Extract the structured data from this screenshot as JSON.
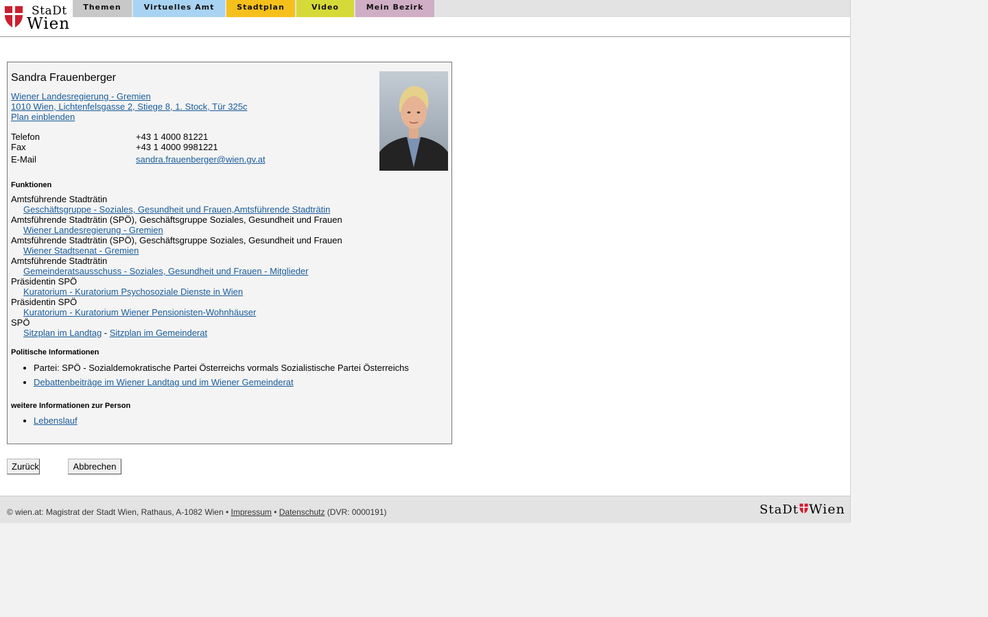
{
  "header": {
    "logo": {
      "word_top": "StaDt",
      "word_bottom": "Wien",
      "shield_colors": [
        "#cc1e2f",
        "#ffffff"
      ]
    },
    "nav_tabs": [
      {
        "label": "Themen",
        "color": "#c8c8c8"
      },
      {
        "label": "Virtuelles Amt",
        "color": "#a9d3f2"
      },
      {
        "label": "Stadtplan",
        "color": "#f6c01c"
      },
      {
        "label": "Video",
        "color": "#d6da38"
      },
      {
        "label": "Mein Bezirk",
        "color": "#d0aec5"
      }
    ]
  },
  "person": {
    "name": "Sandra Frauenberger",
    "org_link": "Wiener Landesregierung - Gremien ",
    "address_link": "1010 Wien, Lichtenfelsgasse 2, Stiege 8, 1. Stock, Tür 325c",
    "map_link": "Plan einblenden",
    "contact": {
      "phone_label": "Telefon",
      "phone": "+43 1 4000 81221",
      "fax_label": "Fax",
      "fax": "+43 1 4000 9981221",
      "email_label": "E-Mail",
      "email": "sandra.frauenberger@wien.gv.at"
    },
    "functions_heading": "Funktionen",
    "functions": [
      {
        "title": "Amtsführende Stadträtin",
        "link": "Geschäftsgruppe - Soziales, Gesundheit und Frauen,Amtsführende Stadträtin"
      },
      {
        "title": "Amtsführende Stadträtin (SPÖ), Geschäftsgruppe Soziales, Gesundheit und Frauen",
        "link": "Wiener Landesregierung - Gremien"
      },
      {
        "title": "Amtsführende Stadträtin (SPÖ), Geschäftsgruppe Soziales, Gesundheit und Frauen",
        "link": "Wiener Stadtsenat - Gremien"
      },
      {
        "title": "Amtsführende Stadträtin",
        "link": "Gemeinderatsausschuss - Soziales, Gesundheit und Frauen - Mitglieder"
      },
      {
        "title": "Präsidentin SPÖ",
        "link": "Kuratorium - Kuratorium Psychosoziale Dienste in Wien"
      },
      {
        "title": "Präsidentin SPÖ",
        "link": "Kuratorium - Kuratorium Wiener Pensionisten-Wohnhäuser"
      }
    ],
    "party": {
      "title": "SPÖ",
      "link1": "Sitzplan im Landtag",
      "separator": " - ",
      "link2": "Sitzplan im Gemeinderat"
    },
    "political_heading": "Politische Informationen",
    "political_items": [
      "Partei: SPÖ - Sozialdemokratische Partei Österreichs vormals Sozialistische Partei Österreichs",
      "Debattenbeiträge im Wiener Landtag und im Wiener Gemeinderat"
    ],
    "more_heading": "weitere Informationen zur Person",
    "more_items": [
      "Lebenslauf"
    ]
  },
  "buttons": {
    "back": "Zurück",
    "cancel": "Abbrechen"
  },
  "footer": {
    "copyright": "© wien.at: Magistrat der Stadt Wien, Rathaus, A-1082 Wien • ",
    "impressum": "Impressum",
    "sep": " • ",
    "datenschutz": "Datenschutz",
    "dvr": " (DVR: 0000191)",
    "logo_left": "StaDt",
    "logo_right": "Wien"
  }
}
